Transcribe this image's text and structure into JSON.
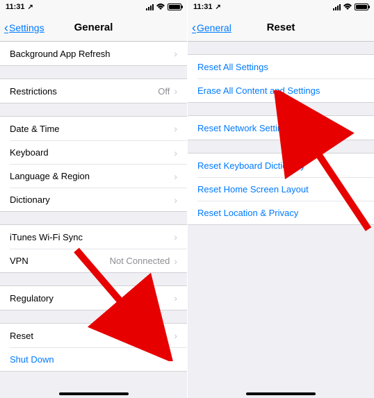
{
  "status": {
    "time": "11:31",
    "location_icon": "↗"
  },
  "phone1": {
    "back_label": "Settings",
    "title": "General",
    "rows": {
      "bg_refresh": "Background App Refresh",
      "restrictions": "Restrictions",
      "restrictions_value": "Off",
      "date_time": "Date & Time",
      "keyboard": "Keyboard",
      "language_region": "Language & Region",
      "dictionary": "Dictionary",
      "itunes_wifi": "iTunes Wi-Fi Sync",
      "vpn": "VPN",
      "vpn_value": "Not Connected",
      "regulatory": "Regulatory",
      "reset": "Reset",
      "shutdown": "Shut Down"
    }
  },
  "phone2": {
    "back_label": "General",
    "title": "Reset",
    "rows": {
      "reset_all": "Reset All Settings",
      "erase_all": "Erase All Content and Settings",
      "reset_network": "Reset Network Settings",
      "reset_keyboard": "Reset Keyboard Dictionary",
      "reset_home": "Reset Home Screen Layout",
      "reset_location": "Reset Location & Privacy"
    }
  }
}
